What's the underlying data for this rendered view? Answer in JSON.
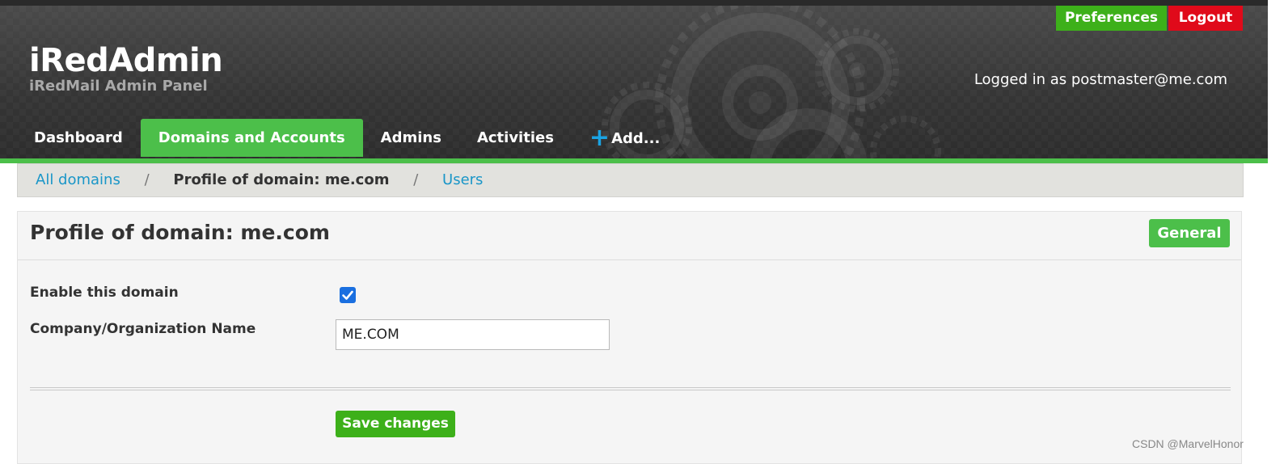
{
  "app": {
    "title": "iRedAdmin",
    "subtitle": "iRedMail Admin Panel"
  },
  "top_buttons": {
    "preferences": "Preferences",
    "logout": "Logout"
  },
  "session": {
    "logged_in_text": "Logged in as postmaster@me.com"
  },
  "nav": {
    "items": [
      {
        "label": "Dashboard"
      },
      {
        "label": "Domains and Accounts"
      },
      {
        "label": "Admins"
      },
      {
        "label": "Activities"
      },
      {
        "label": "Add..."
      }
    ],
    "active": "Domains and Accounts"
  },
  "breadcrumb": {
    "items": [
      "All domains",
      "Profile of domain: me.com",
      "Users"
    ],
    "separator": "/"
  },
  "panel": {
    "title": "Profile of domain: me.com",
    "tab": "General"
  },
  "form": {
    "enable_label": "Enable this domain",
    "enable_checked": true,
    "company_label": "Company/Organization Name",
    "company_value": "ME.COM",
    "save_label": "Save changes"
  },
  "watermark": "CSDN @MarvelHonor",
  "colors": {
    "accent_green": "#4cbf4a",
    "button_green": "#3db01a",
    "logout_red": "#e00a1a",
    "link_blue": "#1996c8",
    "header_dark": "#353535"
  }
}
